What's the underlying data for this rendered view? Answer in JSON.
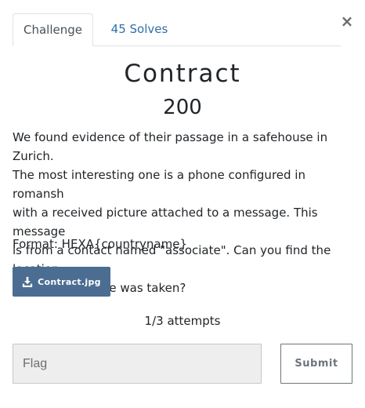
{
  "modal": {
    "close_label": "×",
    "tabs": [
      {
        "label": "Challenge"
      },
      {
        "label": "45 Solves"
      }
    ],
    "challenge": {
      "name": "Contract",
      "value": "200",
      "description": "We found evidence of their passage in a safehouse in Zurich.\nThe most interesting one is a phone configured in romansh\nwith a received picture attached to a message. This message\nis from a contact named \"associate\". Can you find the location\nwhere the picture was taken?",
      "format": "Format: HEXA{countryname}",
      "file_label": "Contract.jpg",
      "file_icon": "download-icon",
      "attempts": "1/3 attempts"
    },
    "flag_placeholder": "Flag",
    "submit_label": "Submit"
  },
  "colors": {
    "file_button_bg": "#4b6d92",
    "tab_link": "#2f6ea7",
    "input_bg": "#eeeeee"
  }
}
